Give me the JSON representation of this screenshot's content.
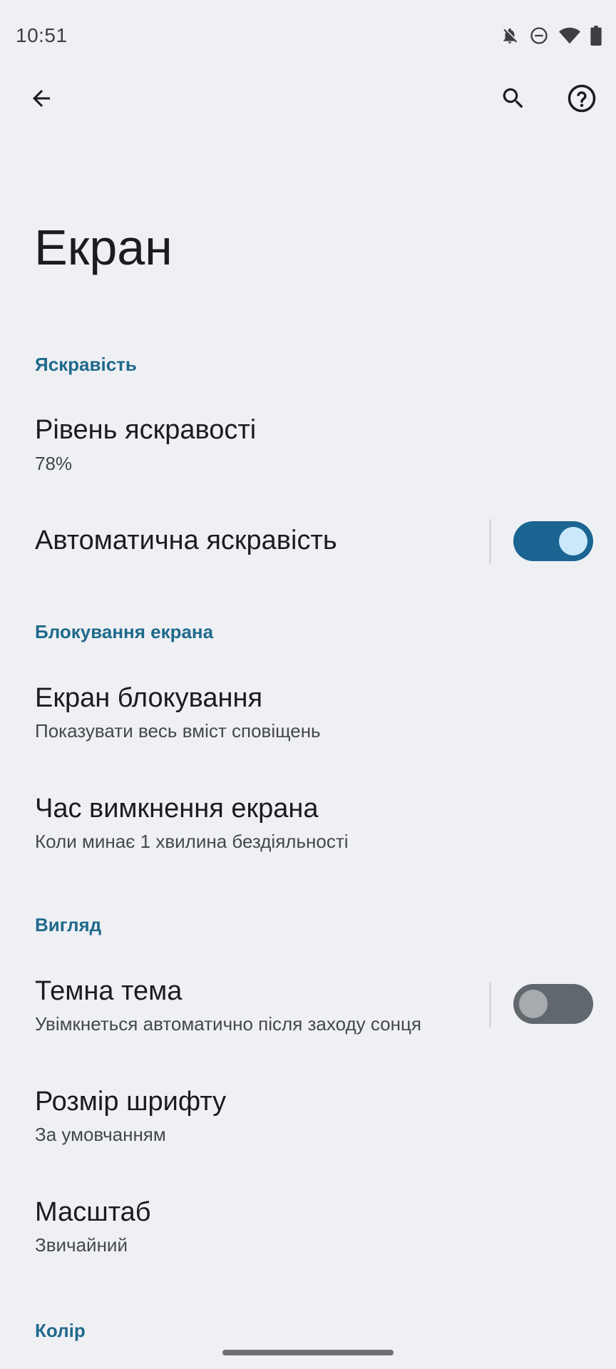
{
  "status_bar": {
    "time": "10:51",
    "icons": [
      "notifications-off-icon",
      "do-not-disturb-icon",
      "wifi-icon",
      "battery-icon"
    ]
  },
  "app_bar": {
    "back_icon": "arrow-back-icon",
    "search_icon": "search-icon",
    "help_icon": "help-icon"
  },
  "page": {
    "title": "Екран"
  },
  "sections": {
    "brightness": {
      "header": "Яскравість",
      "level": {
        "title": "Рівень яскравості",
        "summary": "78%"
      },
      "auto": {
        "title": "Автоматична яскравість",
        "enabled": true
      }
    },
    "lock": {
      "header": "Блокування екрана",
      "lock_screen": {
        "title": "Екран блокування",
        "summary": "Показувати весь вміст сповіщень"
      },
      "timeout": {
        "title": "Час вимкнення екрана",
        "summary": "Коли минає 1 хвилина бездіяльності"
      }
    },
    "appearance": {
      "header": "Вигляд",
      "dark_theme": {
        "title": "Темна тема",
        "summary": "Увімкнеться автоматично після заходу сонця",
        "enabled": false
      },
      "font_size": {
        "title": "Розмір шрифту",
        "summary": "За умовчанням"
      },
      "display_size": {
        "title": "Масштаб",
        "summary": "Звичайний"
      }
    },
    "color": {
      "header": "Колір"
    }
  },
  "colors": {
    "accent": "#1f6a8c",
    "switch_on": "#1a6591",
    "switch_off": "#60686e",
    "background": "#eff0f4"
  }
}
